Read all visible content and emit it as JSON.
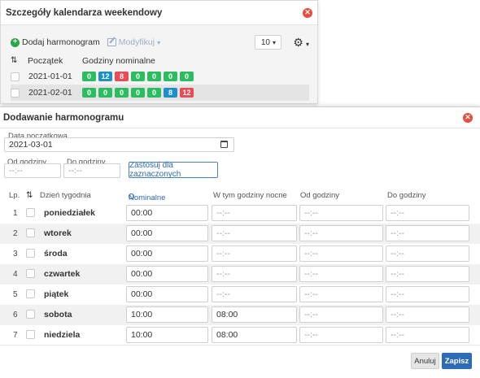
{
  "background_dialog": {
    "title": "Szczegóły kalendarza weekendowy",
    "close": "✕",
    "toolbar": {
      "add_label": "Dodaj harmonogram",
      "modify_label": "Modyfikuj",
      "page_size": "10",
      "caret": "▾"
    },
    "columns": {
      "sort_icon": "⇅",
      "date": "Początek",
      "hours": "Godziny nominalne"
    },
    "rows": [
      {
        "date": "2021-01-01",
        "badges": [
          {
            "value": "0",
            "color": "green"
          },
          {
            "value": "12",
            "color": "blue"
          },
          {
            "value": "8",
            "color": "red"
          },
          {
            "value": "0",
            "color": "green"
          },
          {
            "value": "0",
            "color": "green"
          },
          {
            "value": "0",
            "color": "green"
          },
          {
            "value": "0",
            "color": "green"
          }
        ]
      },
      {
        "date": "2021-02-01",
        "badges": [
          {
            "value": "0",
            "color": "green"
          },
          {
            "value": "0",
            "color": "green"
          },
          {
            "value": "0",
            "color": "green"
          },
          {
            "value": "0",
            "color": "green"
          },
          {
            "value": "0",
            "color": "green"
          },
          {
            "value": "8",
            "color": "blue"
          },
          {
            "value": "12",
            "color": "red"
          }
        ]
      }
    ]
  },
  "dialog": {
    "title": "Dodawanie harmonogramu",
    "close": "✕",
    "start_date_label": "Data początkowa",
    "start_date_value": "2021-03-01",
    "from_label": "Od godziny",
    "from_placeholder": "--:--",
    "to_label": "Do godziny",
    "to_placeholder": "--:--",
    "apply_button": "Zastosuj dla zaznaczonych",
    "table_headers": {
      "lp": "Lp.",
      "sort": "⇅",
      "day": "Dzień tygodnia",
      "nominal": "Nominalne godziny",
      "night": "W tym godziny nocne",
      "from": "Od godziny",
      "to": "Do godziny"
    },
    "rows": [
      {
        "lp": "1",
        "day": "poniedziałek",
        "nominal": "00:00",
        "night": "--:--",
        "from": "--:--",
        "to": "--:--"
      },
      {
        "lp": "2",
        "day": "wtorek",
        "nominal": "00:00",
        "night": "--:--",
        "from": "--:--",
        "to": "--:--"
      },
      {
        "lp": "3",
        "day": "środa",
        "nominal": "00:00",
        "night": "--:--",
        "from": "--:--",
        "to": "--:--"
      },
      {
        "lp": "4",
        "day": "czwartek",
        "nominal": "00:00",
        "night": "--:--",
        "from": "--:--",
        "to": "--:--"
      },
      {
        "lp": "5",
        "day": "piątek",
        "nominal": "00:00",
        "night": "--:--",
        "from": "--:--",
        "to": "--:--"
      },
      {
        "lp": "6",
        "day": "sobota",
        "nominal": "10:00",
        "night": "08:00",
        "from": "--:--",
        "to": "--:--"
      },
      {
        "lp": "7",
        "day": "niedziela",
        "nominal": "10:00",
        "night": "08:00",
        "from": "--:--",
        "to": "--:--"
      }
    ],
    "cancel_button": "Anuluj",
    "save_button": "Zapisz"
  },
  "colors": {
    "green": "#2dbc62",
    "blue": "#1d8fc9",
    "red": "#e84c56",
    "primary": "#2c6bb5",
    "close": "#e74c3c"
  }
}
